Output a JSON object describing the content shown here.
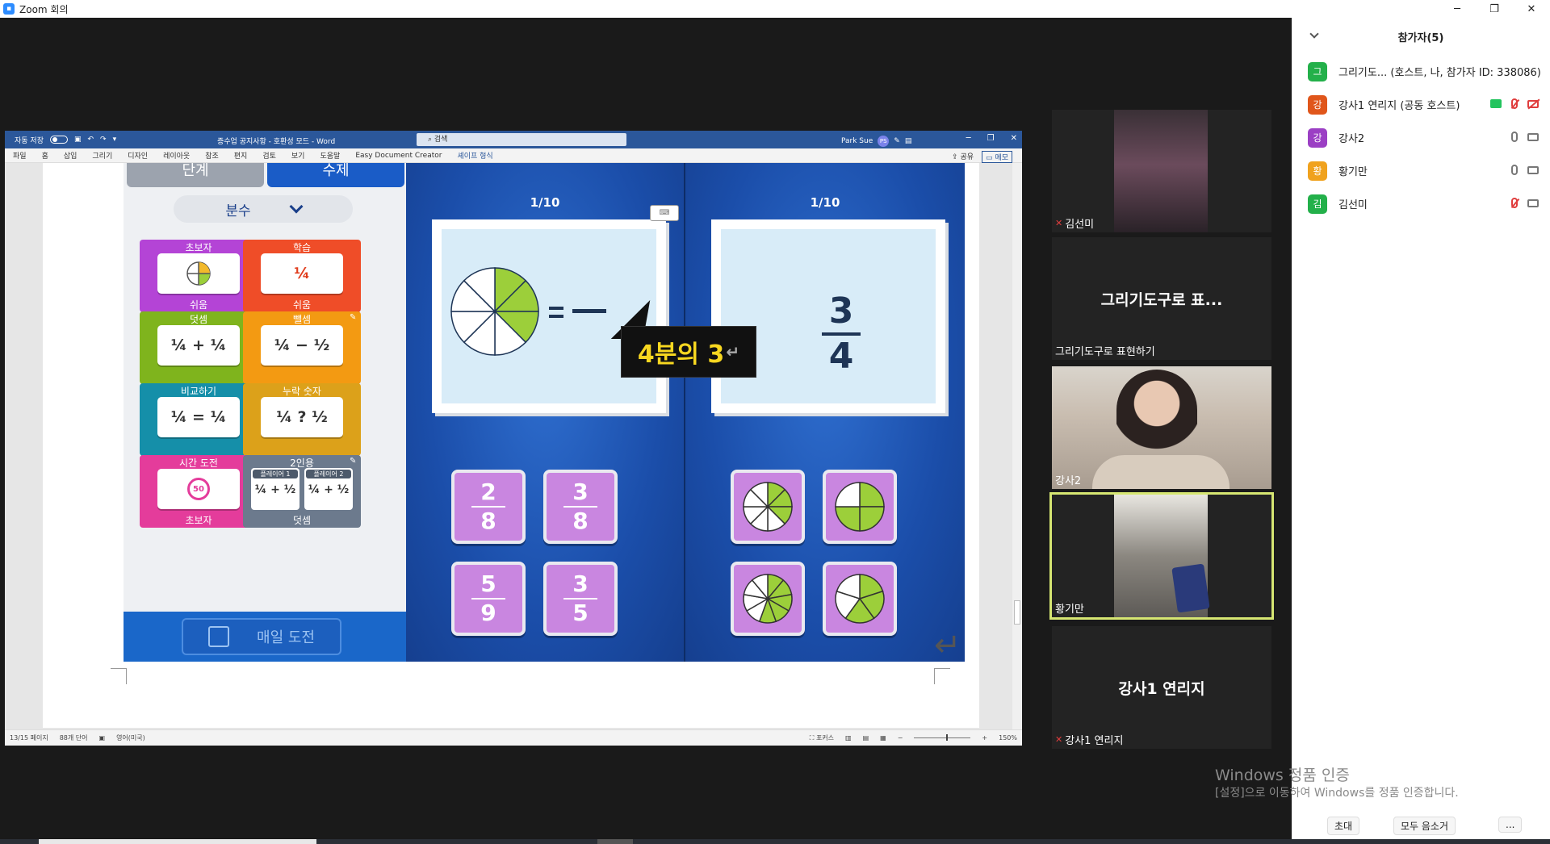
{
  "zoom": {
    "title": "Zoom 회의",
    "minimize": "─",
    "restore": "❐",
    "close": "✕"
  },
  "word": {
    "autosave": "자동 저장",
    "doc_title": "증수업 공지사항 - 호환성 모드 - Word",
    "search_placeholder": "검색",
    "user_name": "Park Sue",
    "user_initials": "PS",
    "menu": [
      "파일",
      "홈",
      "삽입",
      "그리기",
      "디자인",
      "레이아웃",
      "참조",
      "편지",
      "검토",
      "보기",
      "도움말",
      "Easy Document Creator",
      "셰이프 형식"
    ],
    "share": "공유",
    "memo": "메모",
    "status": {
      "page": "13/15 페이지",
      "words": "88개 단어",
      "lang": "영어(미국)",
      "focus": "포커스",
      "zoom": "150%"
    }
  },
  "game": {
    "tab_left": "단계",
    "tab_right": "수제",
    "dropdown": "분수",
    "tiles": [
      {
        "top": "초보자",
        "card": "",
        "bottom": "쉬움",
        "color": "#b444d6"
      },
      {
        "top": "학습",
        "card": "¼",
        "bottom": "쉬움",
        "color": "#ef4d28"
      },
      {
        "top": "덧셈",
        "card": "¼ + ¼",
        "bottom": "",
        "color": "#7fb41d"
      },
      {
        "top": "뺄셈",
        "card": "¼ − ½",
        "bottom": "",
        "color": "#f39a12"
      },
      {
        "top": "비교하기",
        "card": "¼ = ¼",
        "bottom": "",
        "color": "#158fa9"
      },
      {
        "top": "누락 숫자",
        "card": "¼ ? ½",
        "bottom": "",
        "color": "#dca11a"
      },
      {
        "top": "시간 도전",
        "card": "50",
        "bottom": "초보자",
        "color": "#e43c9b"
      },
      {
        "top": "2인용",
        "card": "",
        "bottom": "덧셈",
        "color": "#6c7a8d"
      }
    ],
    "two_player": {
      "p1": "플레이어 1",
      "p2": "플레이어 2",
      "eq": "¼ + ½"
    },
    "daily": "매일 도전",
    "left_board": {
      "counter": "1/10",
      "answers": [
        {
          "num": "2",
          "den": "8"
        },
        {
          "num": "3",
          "den": "8"
        },
        {
          "num": "5",
          "den": "9"
        },
        {
          "num": "3",
          "den": "5"
        }
      ]
    },
    "right_board": {
      "counter": "1/10",
      "fraction": {
        "num": "3",
        "den": "4"
      },
      "tooltip": "4분의  3"
    }
  },
  "gallery": [
    {
      "name": "김선미",
      "muted": true
    },
    {
      "name": "그리기도구로 표현하기",
      "center": "그리기도구로 표...",
      "muted": false
    },
    {
      "name": "강사2",
      "muted": false
    },
    {
      "name": "황기만",
      "muted": false,
      "active": true
    },
    {
      "name": "강사1 연리지",
      "center": "강사1 연리지",
      "muted": true
    }
  ],
  "participants": {
    "title": "참가자(5)",
    "list": [
      {
        "initial": "그",
        "name": "그리기도...  (호스트, 나, 참가자 ID: 338086)",
        "color": "#23b04a"
      },
      {
        "initial": "강",
        "name": "강사1 연리지 (공동 호스트)",
        "color": "#e0561b"
      },
      {
        "initial": "강",
        "name": "강사2",
        "color": "#9b3fc4"
      },
      {
        "initial": "황",
        "name": "황기만",
        "color": "#f0a21e"
      },
      {
        "initial": "김",
        "name": "김선미",
        "color": "#23b04a"
      }
    ],
    "invite": "초대",
    "mute_all": "모두 음소거",
    "more": "..."
  },
  "windows": {
    "line1": "Windows 정품 인증",
    "line2": "[설정]으로 이동하여 Windows를 정품 인증합니다."
  }
}
